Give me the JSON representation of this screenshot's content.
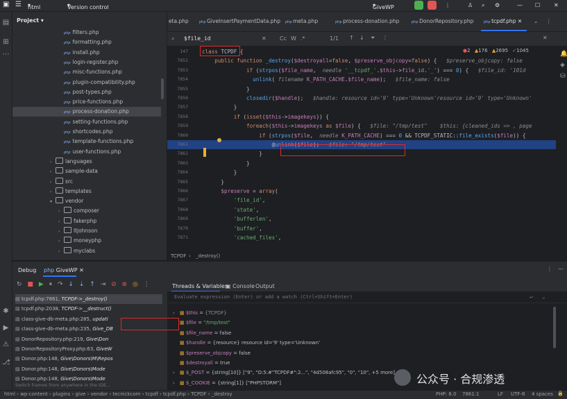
{
  "titlebar": {
    "project_name": "html",
    "vcs_label": "Version control",
    "run_config": "GiveWP"
  },
  "project_panel": {
    "title": "Project",
    "items": [
      {
        "label": "filters.php",
        "type": "php",
        "indent": 2
      },
      {
        "label": "formatting.php",
        "type": "php",
        "indent": 2
      },
      {
        "label": "install.php",
        "type": "php",
        "indent": 2
      },
      {
        "label": "login-register.php",
        "type": "php",
        "indent": 2
      },
      {
        "label": "misc-functions.php",
        "type": "php",
        "indent": 2
      },
      {
        "label": "plugin-compatibility.php",
        "type": "php",
        "indent": 2
      },
      {
        "label": "post-types.php",
        "type": "php",
        "indent": 2
      },
      {
        "label": "price-functions.php",
        "type": "php",
        "indent": 2
      },
      {
        "label": "process-donation.php",
        "type": "php",
        "indent": 2,
        "selected": true
      },
      {
        "label": "setting-functions.php",
        "type": "php",
        "indent": 2
      },
      {
        "label": "shortcodes.php",
        "type": "php",
        "indent": 2
      },
      {
        "label": "template-functions.php",
        "type": "php",
        "indent": 2
      },
      {
        "label": "user-functions.php",
        "type": "php",
        "indent": 2
      },
      {
        "label": "languages",
        "type": "folder",
        "indent": 1
      },
      {
        "label": "sample-data",
        "type": "folder",
        "indent": 1
      },
      {
        "label": "src",
        "type": "folder",
        "indent": 1
      },
      {
        "label": "templates",
        "type": "folder",
        "indent": 1
      },
      {
        "label": "vendor",
        "type": "folder",
        "indent": 1,
        "open": true
      },
      {
        "label": "composer",
        "type": "folder",
        "indent": 2
      },
      {
        "label": "fakerphp",
        "type": "folder",
        "indent": 2
      },
      {
        "label": "ltjohnson",
        "type": "folder",
        "indent": 2
      },
      {
        "label": "moneyphp",
        "type": "folder",
        "indent": 2
      },
      {
        "label": "myclabs",
        "type": "folder",
        "indent": 2
      }
    ]
  },
  "tabs": [
    {
      "label": "eta.php"
    },
    {
      "label": "GiveInsertPaymentData.php"
    },
    {
      "label": "meta.php"
    },
    {
      "label": "process-donation.php"
    },
    {
      "label": "DonorRepository.php"
    },
    {
      "label": "tcpdf.php",
      "active": true
    }
  ],
  "findbar": {
    "query": "$file_id",
    "match_case": "Cc",
    "words": "W",
    "regex": ".*",
    "results": "1/1"
  },
  "inspections": {
    "errors": "2",
    "warnings": "176",
    "weak": "2695",
    "typos": "1045"
  },
  "editor_lines": [
    {
      "n": "147",
      "segs": [
        [
          "kw",
          "class "
        ],
        [
          "plain",
          "TCPDF {"
        ]
      ]
    },
    {
      "n": "7852",
      "segs": [
        [
          "kw",
          "    public function "
        ],
        [
          "fn",
          "_destroy"
        ],
        [
          "plain",
          "("
        ],
        [
          "var",
          "$destroyall"
        ],
        [
          "plain",
          "="
        ],
        [
          "kw",
          "false"
        ],
        [
          "plain",
          ", "
        ],
        [
          "var",
          "$preserve_objcopy"
        ],
        [
          "plain",
          "="
        ],
        [
          "kw",
          "false"
        ],
        [
          "plain",
          ") {   "
        ],
        [
          "hint",
          "$preserve_objcopy: false   "
        ]
      ]
    },
    {
      "n": "7853",
      "segs": [
        [
          "kw",
          "              if "
        ],
        [
          "plain",
          "("
        ],
        [
          "fn",
          "strpos"
        ],
        [
          "plain",
          "("
        ],
        [
          "var",
          "$file_name"
        ],
        [
          "plain",
          ",  "
        ],
        [
          "hint",
          "needle"
        ],
        [
          "str",
          " '__tcpdf_'"
        ],
        [
          "plain",
          "."
        ],
        [
          "var",
          "$this"
        ],
        [
          "plain",
          "->"
        ],
        [
          "var",
          "file_id"
        ],
        [
          "plain",
          "."
        ],
        [
          "str",
          "'_'"
        ],
        [
          "plain",
          ") === "
        ],
        [
          "fn",
          "0"
        ],
        [
          "plain",
          ") {   "
        ],
        [
          "hint",
          "$file_id: '101d"
        ]
      ]
    },
    {
      "n": "7854",
      "segs": [
        [
          "fn",
          "                unlink"
        ],
        [
          "plain",
          "( "
        ],
        [
          "hint",
          "filename"
        ],
        [
          "var",
          " K_PATH_CACHE"
        ],
        [
          "plain",
          "."
        ],
        [
          "var",
          "$file_name"
        ],
        [
          "plain",
          ");   "
        ],
        [
          "hint",
          "$file_name: false"
        ]
      ]
    },
    {
      "n": "7855",
      "segs": [
        [
          "plain",
          "              }"
        ]
      ]
    },
    {
      "n": "7856",
      "segs": [
        [
          "fn",
          "              closedir"
        ],
        [
          "plain",
          "("
        ],
        [
          "var",
          "$handle"
        ],
        [
          "plain",
          ");   "
        ],
        [
          "hint",
          "$handle: resource id='9' type='Unknown'resource id='9' type='Unknown'"
        ]
      ]
    },
    {
      "n": "7857",
      "segs": [
        [
          "plain",
          "          }"
        ]
      ]
    },
    {
      "n": "7858",
      "segs": [
        [
          "kw",
          "          if "
        ],
        [
          "plain",
          "("
        ],
        [
          "kw",
          "isset"
        ],
        [
          "plain",
          "("
        ],
        [
          "var",
          "$this"
        ],
        [
          "plain",
          "->"
        ],
        [
          "var",
          "imagekeys"
        ],
        [
          "plain",
          ")) {"
        ]
      ]
    },
    {
      "n": "7859",
      "segs": [
        [
          "kw",
          "              foreach"
        ],
        [
          "plain",
          "("
        ],
        [
          "var",
          "$this"
        ],
        [
          "plain",
          "->"
        ],
        [
          "var",
          "imagekeys"
        ],
        [
          "kw",
          " as "
        ],
        [
          "var",
          "$file"
        ],
        [
          "plain",
          ") {   "
        ],
        [
          "hint",
          "$file: \"/tmp/test\"    $this: {cleaned_ids => , page"
        ]
      ]
    },
    {
      "n": "7860",
      "segs": [
        [
          "kw",
          "                  if "
        ],
        [
          "plain",
          "("
        ],
        [
          "fn",
          "strpos"
        ],
        [
          "plain",
          "("
        ],
        [
          "var",
          "$file"
        ],
        [
          "plain",
          ",  "
        ],
        [
          "hint",
          "needle"
        ],
        [
          "var",
          " K_PATH_CACHE"
        ],
        [
          "plain",
          ") === "
        ],
        [
          "fn",
          "0"
        ],
        [
          "plain",
          " && TCPDF_STATIC::"
        ],
        [
          "fn",
          "file_exists"
        ],
        [
          "plain",
          "("
        ],
        [
          "var",
          "$file"
        ],
        [
          "plain",
          ")) {"
        ]
      ]
    },
    {
      "n": "7861",
      "segs": [
        [
          "plain",
          "                      @"
        ],
        [
          "fn",
          "unlink"
        ],
        [
          "plain",
          "("
        ],
        [
          "var",
          "$file"
        ],
        [
          "plain",
          ");   "
        ],
        [
          "hint",
          "$file: \"/tmp/test\""
        ]
      ],
      "highlight": true
    },
    {
      "n": "7862",
      "segs": [
        [
          "plain",
          "                  }"
        ]
      ]
    },
    {
      "n": "7863",
      "segs": [
        [
          "plain",
          "              }"
        ]
      ]
    },
    {
      "n": "7864",
      "segs": [
        [
          "plain",
          "          }"
        ]
      ]
    },
    {
      "n": "7865",
      "segs": [
        [
          "plain",
          "      }"
        ]
      ]
    },
    {
      "n": "7866",
      "segs": [
        [
          "var",
          "      $preserve"
        ],
        [
          "plain",
          " = "
        ],
        [
          "kw",
          "array"
        ],
        [
          "plain",
          "("
        ]
      ]
    },
    {
      "n": "7867",
      "segs": [
        [
          "str",
          "          'file_id'"
        ],
        [
          "plain",
          ","
        ]
      ]
    },
    {
      "n": "7868",
      "segs": [
        [
          "str",
          "          'state'"
        ],
        [
          "plain",
          ","
        ]
      ]
    },
    {
      "n": "7869",
      "segs": [
        [
          "str",
          "          'bufferlen'"
        ],
        [
          "plain",
          ","
        ]
      ]
    },
    {
      "n": "7870",
      "segs": [
        [
          "str",
          "          'buffer'"
        ],
        [
          "plain",
          ","
        ]
      ]
    },
    {
      "n": "7871",
      "segs": [
        [
          "str",
          "          'cached_files'"
        ],
        [
          "plain",
          ","
        ]
      ]
    }
  ],
  "editor_breadcrumb": [
    "TCPDF",
    "_destroy()"
  ],
  "debug": {
    "tab_debug": "Debug",
    "tab_session": "GiveWP",
    "tab_threads": "Threads & Variables",
    "tab_console": "Console",
    "tab_output": "Output",
    "eval_placeholder": "Evaluate expression (Enter) or add a watch (Ctrl+Shift+Enter)",
    "frames_hint": "Switch frames from anywhere in the IDE..."
  },
  "frames": [
    {
      "file": "tcpdf.php:7861, ",
      "fn": "TCPDF->_destroy()",
      "selected": true
    },
    {
      "file": "tcpdf.php:2038, ",
      "fn": "TCPDF->__destruct()"
    },
    {
      "file": "class-give-db-meta.php:285, ",
      "fn": "updati"
    },
    {
      "file": "class-give-db-meta.php:235, ",
      "fn": "Give_DB"
    },
    {
      "file": "DonorRepository.php:219, ",
      "fn": "Give\\Don"
    },
    {
      "file": "DonorRepositoryProxy.php:63, ",
      "fn": "GiveW"
    },
    {
      "file": "Donor.php:148, ",
      "fn": "Give\\Donors\\M\\Repos"
    },
    {
      "file": "Donor.php:148, ",
      "fn": "Give\\Donors\\Mode"
    },
    {
      "file": "Donor.php:148, ",
      "fn": "Give\\Donors\\Mode"
    }
  ],
  "variables": [
    {
      "name": "$this",
      "value": "{TCPDF}",
      "kind": "type",
      "expand": true
    },
    {
      "name": "$file",
      "value": "\"/tmp/test\"",
      "kind": "str"
    },
    {
      "name": "$file_name",
      "value": "false",
      "kind": "plain"
    },
    {
      "name": "$handle",
      "value": "{resource} resource id='9' type='Unknown'",
      "kind": "plain"
    },
    {
      "name": "$preserve_objcopy",
      "value": "false",
      "kind": "plain"
    },
    {
      "name": "$destroyall",
      "value": "true",
      "kind": "plain"
    },
    {
      "name": "$_POST",
      "value": "{string[10]} [\"9\", \"O:5:#\"TCPDF#\":2...\", \"4d508afc95\", \"0\", \"10\", +5 more]",
      "kind": "plain",
      "expand": true
    },
    {
      "name": "$_COOKIE",
      "value": "{string[1]} [\"PHPSTORM\"]",
      "kind": "plain",
      "expand": true
    }
  ],
  "status": {
    "path": [
      "html",
      "wp-content",
      "plugins",
      "give",
      "vendor",
      "tecnickcom",
      "tcpdf",
      "tcpdf.php",
      "TCPDF",
      "_destroy"
    ],
    "php_version": "PHP: 8.0",
    "position": "7861:1",
    "line_sep": "LF",
    "encoding": "UTF-8",
    "indent": "4 spaces"
  },
  "watermark": "公众号 · 合规渗透",
  "colors": {
    "accent": "#3574f0",
    "annotation": "#e02a2a",
    "run_green": "#4caf50",
    "stop_red": "#e05555"
  }
}
